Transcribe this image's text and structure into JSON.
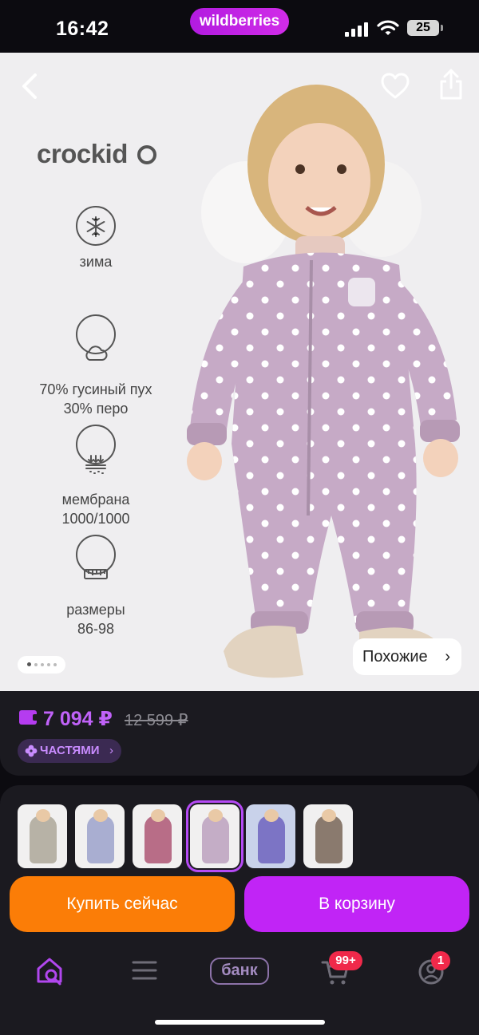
{
  "status_bar": {
    "time": "16:42",
    "app_pill": "wildberries",
    "battery": "25"
  },
  "product": {
    "brand": "crockid",
    "features": [
      {
        "icon": "snowflake-icon",
        "text": "зима"
      },
      {
        "icon": "cloud-icon",
        "text": "70% гусиный пух\n30% перо"
      },
      {
        "icon": "membrane-icon",
        "text": "мембрана\n1000/1000"
      },
      {
        "icon": "ruler-icon",
        "text": "размеры\n86-98"
      }
    ],
    "gallery": {
      "total": 5,
      "current": 1
    },
    "similar_label": "Похожие",
    "similar_chevron": "›"
  },
  "price": {
    "current": "7 094 ₽",
    "old": "12 599 ₽",
    "installments_label": "ЧАСТЯМИ",
    "installments_chevron": "›"
  },
  "variants": [
    {
      "color": "#b7b2a6",
      "selected": false
    },
    {
      "color": "#a9aed1",
      "selected": false
    },
    {
      "color": "#b86d87",
      "selected": false
    },
    {
      "color": "#c4adc6",
      "selected": true
    },
    {
      "color": "#7c74c5",
      "selected": false
    },
    {
      "color": "#8a7a6e",
      "selected": false
    }
  ],
  "actions": {
    "buy_now": "Купить сейчас",
    "add_to_cart": "В корзину"
  },
  "tabbar": {
    "bank_label": "банк",
    "cart_badge": "99+",
    "profile_badge": "1"
  },
  "colors": {
    "accent": "#c124f6",
    "buy": "#fb7d07",
    "price": "#c062f8",
    "badge": "#f0294a"
  }
}
